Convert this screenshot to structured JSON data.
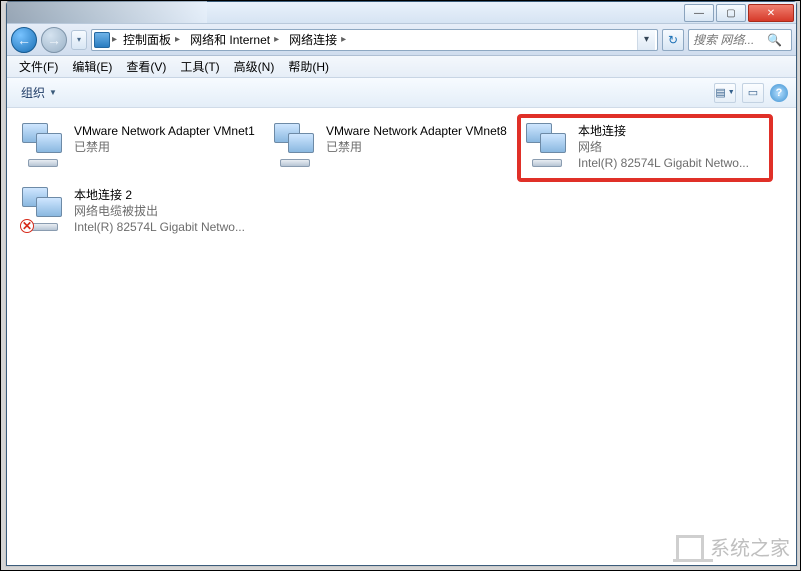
{
  "titlebar": {
    "min": "—",
    "max": "▢",
    "close": "✕"
  },
  "nav": {
    "back_glyph": "←",
    "fwd_glyph": "→",
    "history_glyph": "▾"
  },
  "breadcrumb": {
    "items": [
      "控制面板",
      "网络和 Internet",
      "网络连接"
    ]
  },
  "addr_buttons": {
    "dropdown": "▾",
    "refresh": "↻"
  },
  "search": {
    "placeholder": "搜索 网络...",
    "icon": "🔍"
  },
  "menu": {
    "items": [
      "文件(F)",
      "编辑(E)",
      "查看(V)",
      "工具(T)",
      "高级(N)",
      "帮助(H)"
    ]
  },
  "toolbar": {
    "organize": "组织",
    "dd": "▼",
    "view_glyph": "▤",
    "preview_glyph": "▭",
    "help_glyph": "?"
  },
  "connections": [
    {
      "name": "VMware Network Adapter VMnet1",
      "status": "已禁用",
      "detail": "",
      "error": false,
      "highlight": false
    },
    {
      "name": "VMware Network Adapter VMnet8",
      "status": "已禁用",
      "detail": "",
      "error": false,
      "highlight": false
    },
    {
      "name": "本地连接",
      "status": "网络",
      "detail": "Intel(R) 82574L Gigabit Netwo...",
      "error": false,
      "highlight": true
    },
    {
      "name": "本地连接 2",
      "status": "网络电缆被拔出",
      "detail": "Intel(R) 82574L Gigabit Netwo...",
      "error": true,
      "highlight": false
    }
  ],
  "watermark": "系统之家"
}
